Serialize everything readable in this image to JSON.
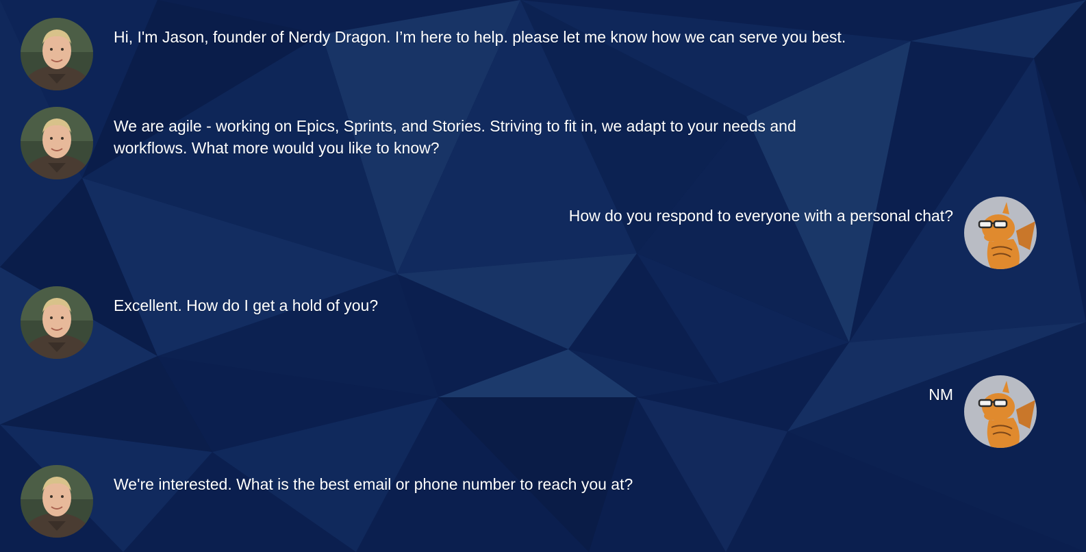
{
  "colors": {
    "background": "#0b1f4f",
    "text": "#ffffff",
    "dragon_orange": "#e08a2e",
    "dragon_avatar_bg": "#b9bcc4"
  },
  "avatars": {
    "agent": "person-photo-icon",
    "user": "dragon-mascot-icon"
  },
  "messages": [
    {
      "side": "left",
      "sender": "agent",
      "text": "Hi, I'm Jason, founder of Nerdy Dragon. I’m here to help. please let me know how we can serve you best."
    },
    {
      "side": "left",
      "sender": "agent",
      "text": "We are agile - working on Epics, Sprints, and Stories. Striving to fit in, we adapt to your needs and workflows. What more would you like to know?"
    },
    {
      "side": "right",
      "sender": "user",
      "text": "How do you respond to everyone with a personal chat?"
    },
    {
      "side": "left",
      "sender": "agent",
      "text": "Excellent. How do I get a hold of you?"
    },
    {
      "side": "right",
      "sender": "user",
      "text": "NM"
    },
    {
      "side": "left",
      "sender": "agent",
      "text": "We're interested. What is the best email or phone number to reach you at?"
    }
  ]
}
